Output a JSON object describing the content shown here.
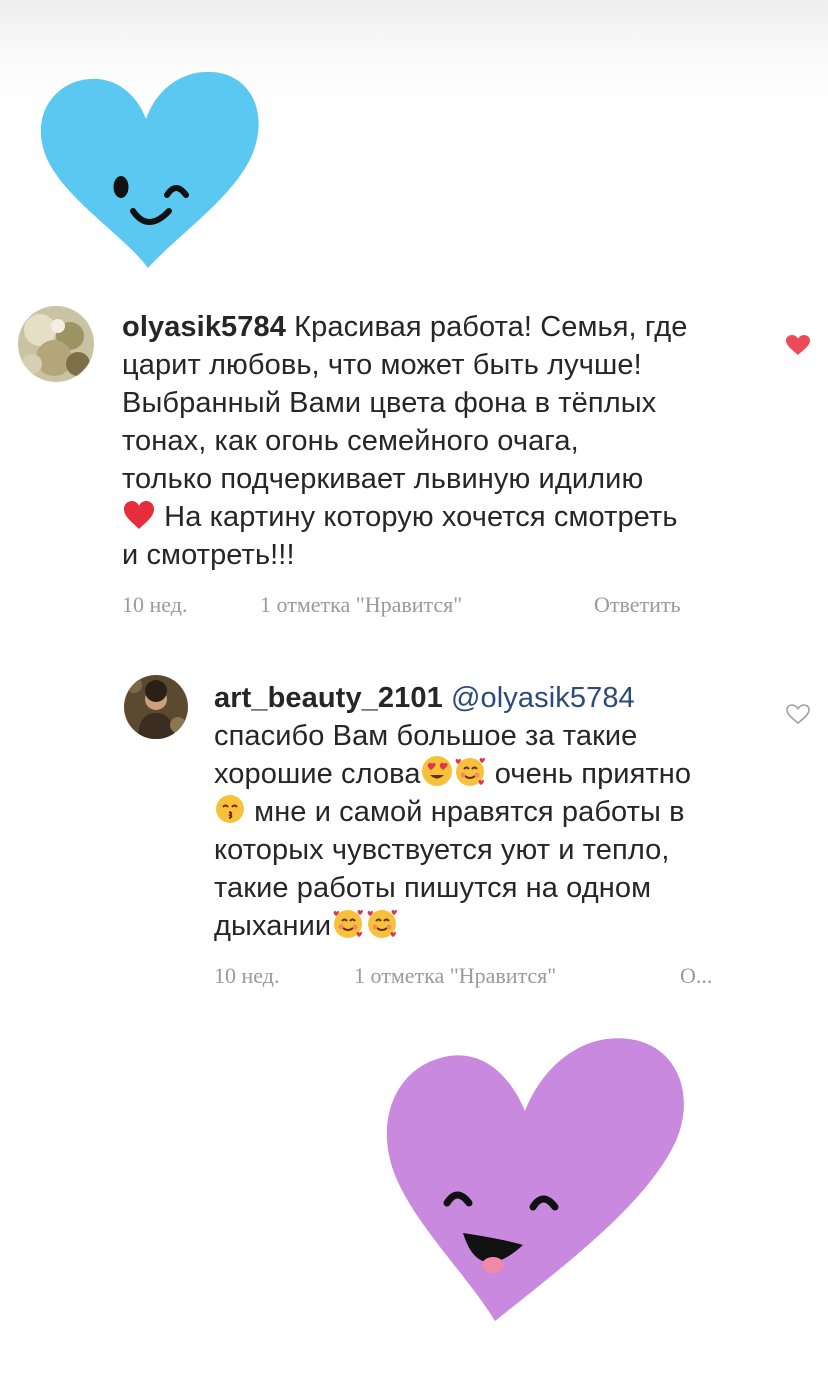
{
  "stickers": [
    {
      "name": "blue-winking-heart-sticker",
      "color": "#5ac8f0"
    },
    {
      "name": "purple-smiling-heart-sticker",
      "color": "#c889df"
    }
  ],
  "comment1": {
    "username": "olyasik5784",
    "text_line1": " Красивая работа! Семья, где",
    "text_line2": "царит любовь, что может быть лучше!",
    "text_line3": "Выбранный Вами цвета фона в тёплых",
    "text_line4": "тонах, как огонь семейного очага,",
    "text_line5": "только подчеркивает львиную идилию",
    "text_line6_emoji": "heart-emoji",
    "text_line6": " На картину которую хочется смотреть",
    "text_line7": "и смотреть!!!",
    "time": "10 нед.",
    "likes": "1 отметка \"Нравится\"",
    "reply": "Ответить",
    "liked": true,
    "like_color": "#ed4956"
  },
  "comment2": {
    "username": "art_beauty_2101",
    "mention": " @olyasik5784",
    "text_line1": "спасибо Вам большое за такие",
    "text_line2a": "хорошие слова",
    "text_line2_emojis": [
      "heart-eyes-emoji",
      "smiling-face-with-hearts-emoji"
    ],
    "text_line2b": " очень приятно",
    "text_line3_emoji": "kissing-face-emoji",
    "text_line3": " мне и самой нравятся работы в",
    "text_line4": "которых чувствуется уют и тепло,",
    "text_line5": "такие работы пишутся на одном",
    "text_line6": "дыхании",
    "text_line6_emojis": [
      "smiling-face-with-hearts-emoji",
      "smiling-face-with-hearts-emoji"
    ],
    "time": "10 нед.",
    "likes": "1 отметка \"Нравится\"",
    "reply": "О...",
    "liked": false
  }
}
